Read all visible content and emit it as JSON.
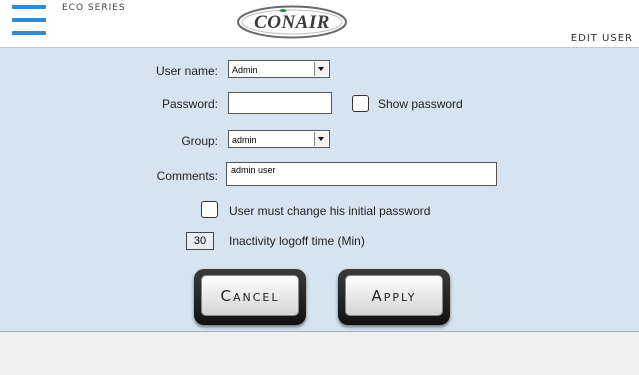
{
  "header": {
    "series_label": "ECO SERIES",
    "logo_text": "CONAIR",
    "page_title": "EDIT USER"
  },
  "form": {
    "username_label": "User name:",
    "username_value": "Admin",
    "password_label": "Password:",
    "password_value": "",
    "show_password_label": "Show password",
    "group_label": "Group:",
    "group_value": "admin",
    "comments_label": "Comments:",
    "comments_value": "admin user",
    "must_change_label": "User must change his initial password",
    "inactivity_value": "30",
    "inactivity_label": "Inactivity logoff time  (Min)"
  },
  "buttons": {
    "cancel": "Cancel",
    "apply": "Apply"
  },
  "colors": {
    "menu_icon": "#2e8bd2",
    "panel_bg": "#d6e3f0",
    "logo_green": "#1a8a3a"
  }
}
